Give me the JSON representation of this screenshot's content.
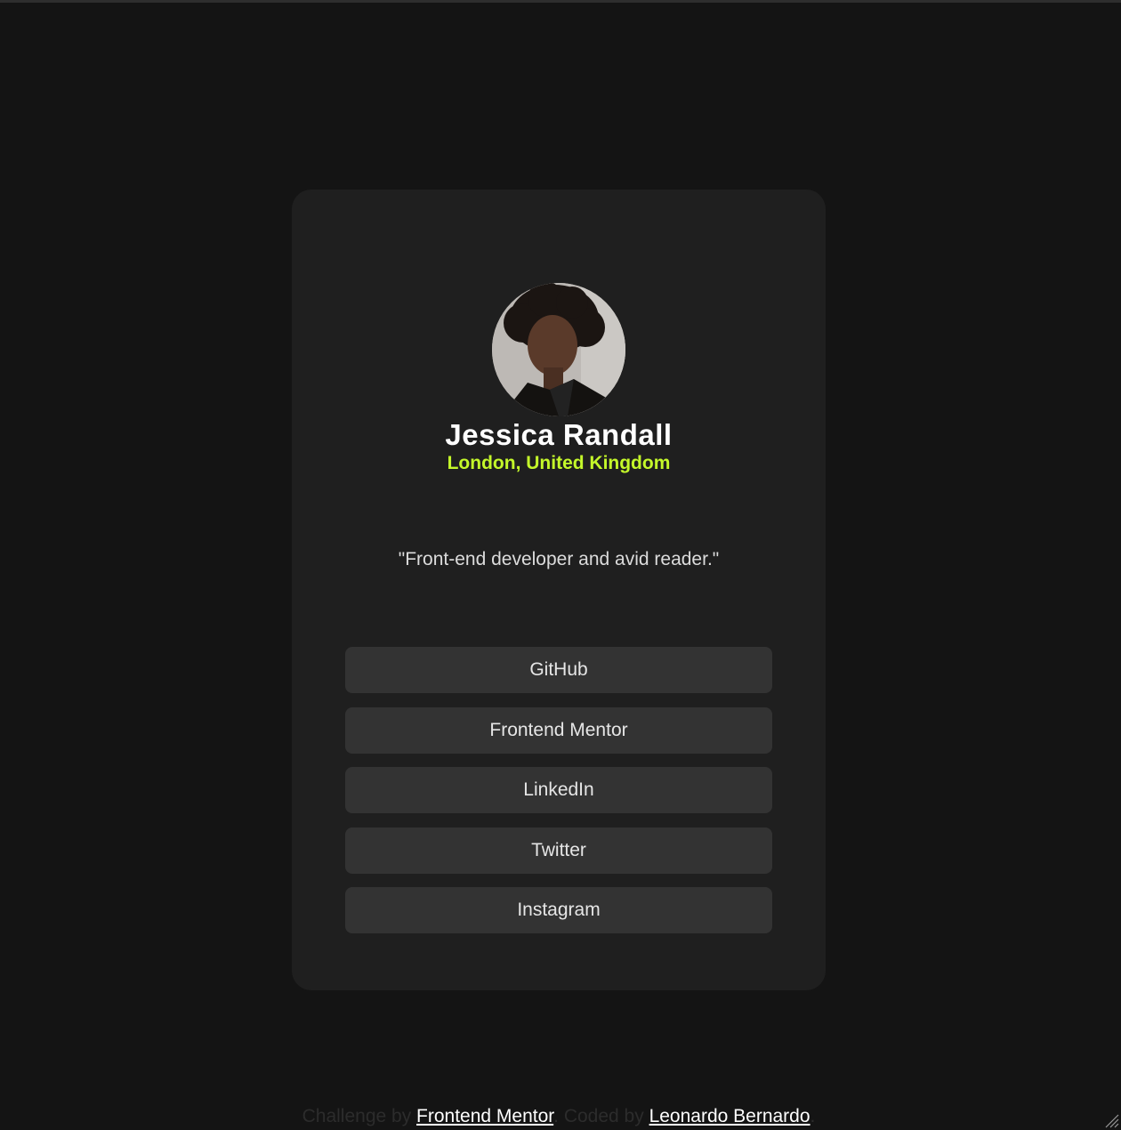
{
  "profile": {
    "name": "Jessica Randall",
    "location": "London, United Kingdom",
    "bio": "\"Front-end developer and avid reader.\""
  },
  "links": [
    {
      "label": "GitHub"
    },
    {
      "label": "Frontend Mentor"
    },
    {
      "label": "LinkedIn"
    },
    {
      "label": "Twitter"
    },
    {
      "label": "Instagram"
    }
  ],
  "footer": {
    "challenge_prefix": "Challenge by",
    "challenge_link": "Frontend Mentor",
    "coded_prefix": "Coded by",
    "coded_link": "Leonardo Bernardo"
  },
  "colors": {
    "background": "#141414",
    "card": "#1f1f1f",
    "button": "#333333",
    "accent": "#c4f82a",
    "text": "#ffffff"
  },
  "icons": {
    "resize": "resize-grip-icon"
  }
}
